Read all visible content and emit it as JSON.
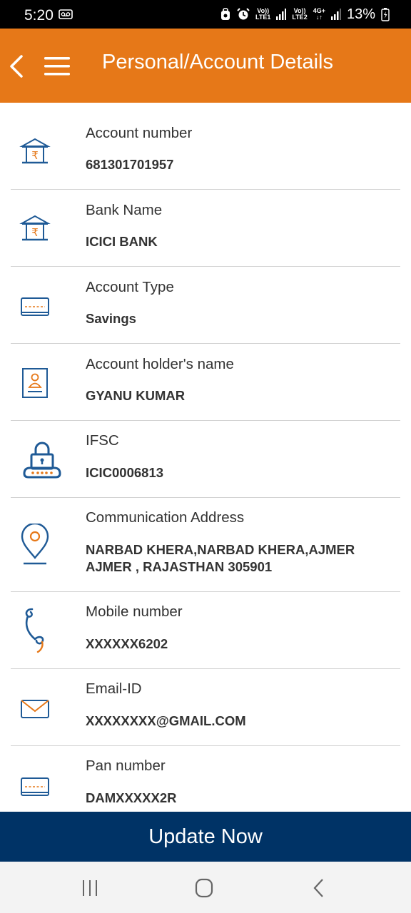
{
  "status_bar": {
    "time": "5:20",
    "sim1_top": "Vo))",
    "sim1_bottom": "LTE1",
    "sim2_top": "Vo))",
    "sim2_bottom": "LTE2",
    "network": "4G+",
    "battery": "13%"
  },
  "header": {
    "title": "Personal/Account Details"
  },
  "rows": [
    {
      "label": "Account number",
      "value": "681301701957",
      "icon": "bank-icon"
    },
    {
      "label": "Bank Name",
      "value": "ICICI BANK",
      "icon": "bank-icon"
    },
    {
      "label": "Account Type",
      "value": "Savings",
      "icon": "card-icon"
    },
    {
      "label": "Account holder's name",
      "value": "GYANU KUMAR",
      "icon": "id-badge-icon"
    },
    {
      "label": "IFSC",
      "value": "ICIC0006813",
      "icon": "lock-icon"
    },
    {
      "label": "Communication Address",
      "value_line1": "NARBAD KHERA,NARBAD KHERA,AJMER",
      "value_line2": "AJMER , RAJASTHAN 305901",
      "icon": "location-pin-icon"
    },
    {
      "label": "Mobile number",
      "value": "XXXXXX6202",
      "icon": "phone-icon"
    },
    {
      "label": "Email-ID",
      "value": "XXXXXXXX@GMAIL.COM",
      "icon": "mail-icon"
    },
    {
      "label": "Pan number",
      "value": "DAMXXXXX2R",
      "icon": "card-icon"
    }
  ],
  "footer": {
    "update_label": "Update Now"
  },
  "colors": {
    "header": "#e67818",
    "button": "#003366",
    "icon_blue": "#1f5a96",
    "icon_orange": "#e67818"
  }
}
